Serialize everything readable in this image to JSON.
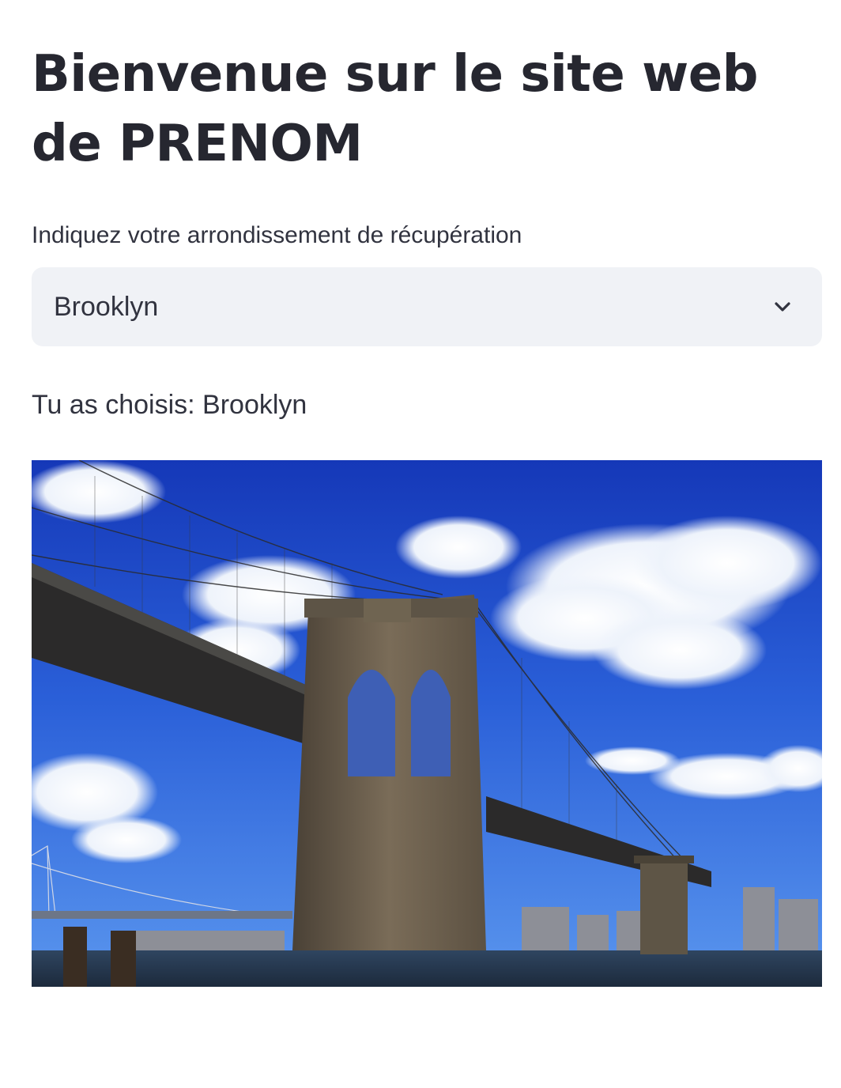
{
  "header": {
    "title": "Bienvenue sur le site web de PRENOM"
  },
  "selector": {
    "label": "Indiquez votre arrondissement de récupération",
    "selected": "Brooklyn",
    "icon": "chevron-down-icon"
  },
  "result": {
    "text": "Tu as choisis: Brooklyn"
  },
  "image": {
    "subject": "brooklyn-bridge-photo"
  },
  "colors": {
    "text": "#31333f",
    "title": "#262730",
    "select_bg": "#f0f2f6"
  }
}
